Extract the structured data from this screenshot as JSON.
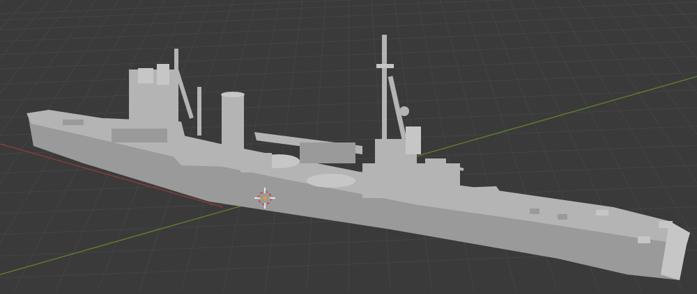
{
  "viewport": {
    "background_color": "#3a3a3a",
    "grid_color": "#444444",
    "x_axis_color": "#8a3a3a",
    "y_axis_color": "#5e7a2e",
    "model_fill": "#b4b4b4",
    "model_shadow": "#9a9a9a",
    "model_highlight": "#c6c6c6",
    "cursor_color": "#c44a4a",
    "object_origin_color": "#e89a2a"
  },
  "scene": {
    "object_type": "warship-model",
    "view_mode": "solid-shading",
    "icons": [
      "3d-cursor-icon",
      "object-origin-icon"
    ]
  }
}
